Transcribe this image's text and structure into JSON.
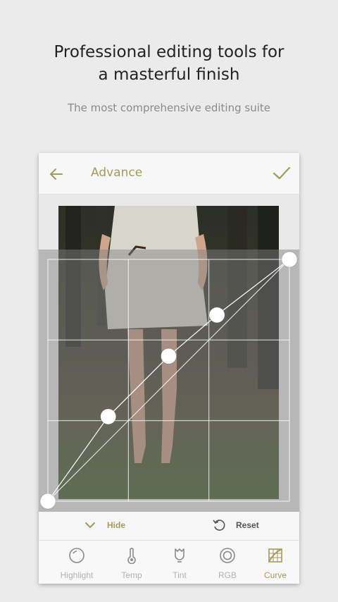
{
  "promo": {
    "headline_line1": "Professional editing tools for",
    "headline_line2": "a masterful finish",
    "subheadline": "The most comprehensive editing suite"
  },
  "screen": {
    "title": "Advance",
    "back_icon": "arrow-left-icon",
    "confirm_icon": "check-icon",
    "accent_color": "#a39b5a"
  },
  "curve_editor": {
    "points": [
      {
        "in": 0,
        "out": 0
      },
      {
        "in": 0.25,
        "out": 0.35
      },
      {
        "in": 0.5,
        "out": 0.6
      },
      {
        "in": 0.7,
        "out": 0.77
      },
      {
        "in": 1,
        "out": 1
      }
    ]
  },
  "actions": {
    "hide_label": "Hide",
    "reset_label": "Reset"
  },
  "tools": [
    {
      "label": "Highlight",
      "icon": "highlight-icon",
      "active": false
    },
    {
      "label": "Temp",
      "icon": "thermometer-icon",
      "active": false
    },
    {
      "label": "Tint",
      "icon": "tint-icon",
      "active": false
    },
    {
      "label": "RGB",
      "icon": "rgb-icon",
      "active": false
    },
    {
      "label": "Curve",
      "icon": "curve-icon",
      "active": true
    }
  ]
}
